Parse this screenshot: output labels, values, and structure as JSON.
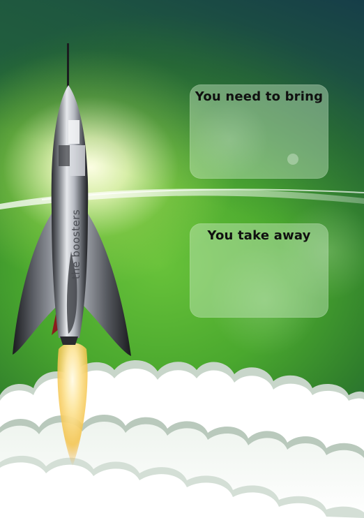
{
  "panels": [
    {
      "title": "You need to bring"
    },
    {
      "title": "You take away"
    }
  ],
  "rocket": {
    "label": "the boosters"
  },
  "colors": {
    "sky_green": "#4aa82e",
    "glow": "#fffbe0",
    "panel_fill": "#d2eecd",
    "rocket_body": "#c9ccd2",
    "rocket_dark": "#2b2c30",
    "flame": "#f4c34a",
    "cloud": "#ffffff"
  },
  "icons": {
    "rocket": "rocket-illustration",
    "flame": "rocket-exhaust-flame",
    "clouds": "cloud-bank"
  }
}
